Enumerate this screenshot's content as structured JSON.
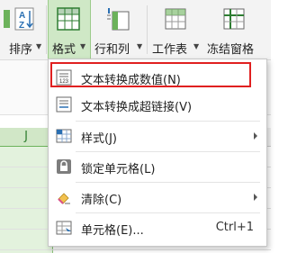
{
  "ribbon": {
    "sort_label": "排序",
    "format_label": "格式",
    "rowcol_label": "行和列",
    "sheet_label": "工作表",
    "freeze_label": "冻结窗格"
  },
  "sheet": {
    "active_column": "J"
  },
  "menu": {
    "items": [
      {
        "label": "文本转换成数值(N)",
        "icon": "text-to-number-icon"
      },
      {
        "label": "文本转换成超链接(V)",
        "icon": "text-to-hyperlink-icon"
      },
      {
        "label": "样式(J)",
        "icon": "style-icon"
      },
      {
        "label": "锁定单元格(L)",
        "icon": "lock-icon"
      },
      {
        "label": "清除(C)",
        "icon": "eraser-icon"
      },
      {
        "label": "单元格(E)...",
        "icon": "cell-icon",
        "shortcut": "Ctrl+1"
      }
    ]
  },
  "colors": {
    "accent_green": "#6cb25b",
    "highlight_red": "#e02020"
  }
}
